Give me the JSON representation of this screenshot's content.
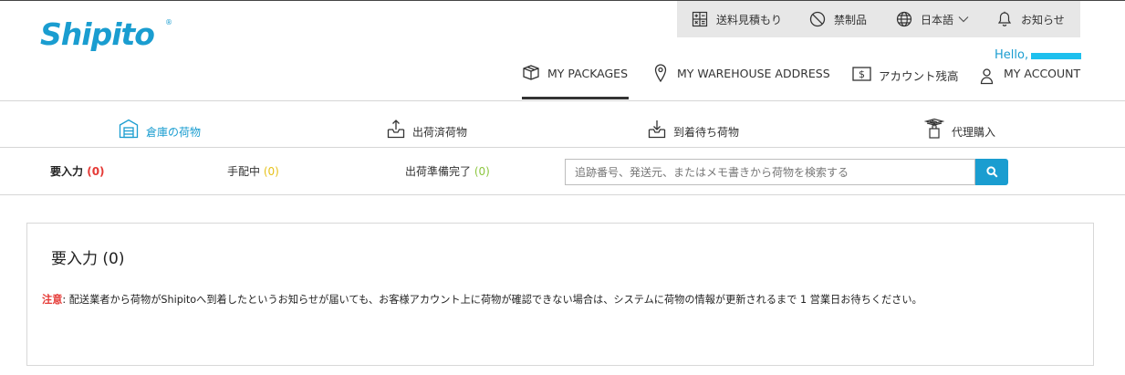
{
  "brand": {
    "logo_text": "Shipito",
    "logo_mark": "®",
    "color": "#1a9dd0"
  },
  "utility_nav": {
    "shipping_estimate": "送料見積もり",
    "prohibited": "禁制品",
    "language": "日本語",
    "notifications": "お知らせ"
  },
  "user": {
    "greeting": "Hello,"
  },
  "main_nav": {
    "packages": "MY PACKAGES",
    "warehouse": "MY WAREHOUSE ADDRESS",
    "balance": "アカウント残高",
    "account": "MY ACCOUNT"
  },
  "category_tabs": [
    {
      "label": "倉庫の荷物",
      "icon": "warehouse-icon",
      "active": true
    },
    {
      "label": "出荷済荷物",
      "icon": "outbox-icon",
      "active": false
    },
    {
      "label": "到着待ち荷物",
      "icon": "inbox-icon",
      "active": false
    },
    {
      "label": "代理購入",
      "icon": "assisted-purchase-icon",
      "active": false
    }
  ],
  "sub_tabs": [
    {
      "label": "要入力",
      "count": "(0)",
      "count_color": "#e53935",
      "active": true
    },
    {
      "label": "手配中",
      "count": "(0)",
      "count_color": "#e6c11a",
      "active": false
    },
    {
      "label": "出荷準備完了",
      "count": "(0)",
      "count_color": "#8cc63f",
      "active": false
    }
  ],
  "search": {
    "placeholder": "追跡番号、発送元、またはメモ書きから荷物を検索する",
    "value": ""
  },
  "panel": {
    "title": "要入力 (0)",
    "notice_label": "注意",
    "notice_text": ": 配送業者から荷物がShipitoへ到着したというお知らせが届いても、お客様アカウント上に荷物が確認できない場合は、システムに荷物の情報が更新されるまで 1 営業日お待ちください。"
  },
  "colors": {
    "accent": "#1a9dd0",
    "danger": "#e53935",
    "warning": "#e6c11a",
    "success": "#8cc63f",
    "util_bg": "#e7e7e7"
  }
}
